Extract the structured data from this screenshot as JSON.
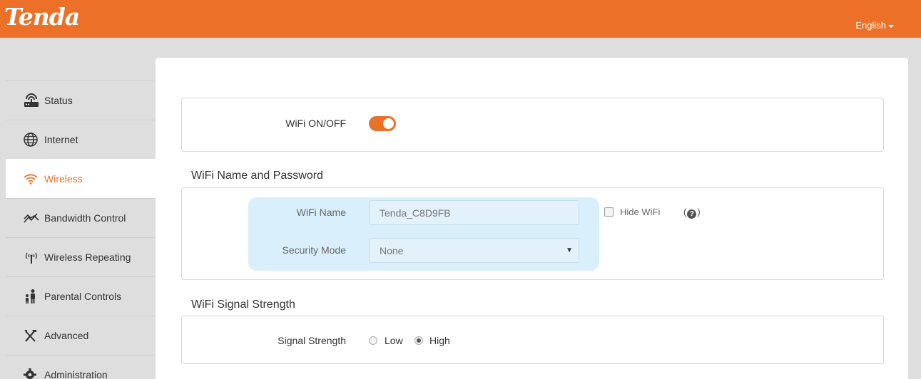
{
  "header": {
    "logo": "Tenda",
    "language": "English",
    "brand_color": "#ec7027"
  },
  "sidebar": {
    "items": [
      {
        "label": "Status",
        "icon": "router-icon"
      },
      {
        "label": "Internet",
        "icon": "globe-icon"
      },
      {
        "label": "Wireless",
        "icon": "wifi-icon",
        "active": true
      },
      {
        "label": "Bandwidth Control",
        "icon": "bandwidth-icon"
      },
      {
        "label": "Wireless Repeating",
        "icon": "antenna-icon"
      },
      {
        "label": "Parental Controls",
        "icon": "family-icon"
      },
      {
        "label": "Advanced",
        "icon": "tools-icon"
      },
      {
        "label": "Administration",
        "icon": "gear-icon"
      }
    ]
  },
  "wifi_switch": {
    "label": "WiFi ON/OFF",
    "state": "on"
  },
  "name_password": {
    "title": "WiFi Name and Password",
    "wifi_name_label": "WiFi Name",
    "wifi_name_value": "Tenda_C8D9FB",
    "hide_wifi_label": "Hide WiFi",
    "hide_wifi_checked": false,
    "help_prefix": "(",
    "help_icon": "?",
    "help_suffix": ")",
    "security_label": "Security Mode",
    "security_value": "None"
  },
  "signal": {
    "title": "WiFi Signal Strength",
    "label": "Signal Strength",
    "options": [
      "Low",
      "High"
    ],
    "selected": "High"
  }
}
